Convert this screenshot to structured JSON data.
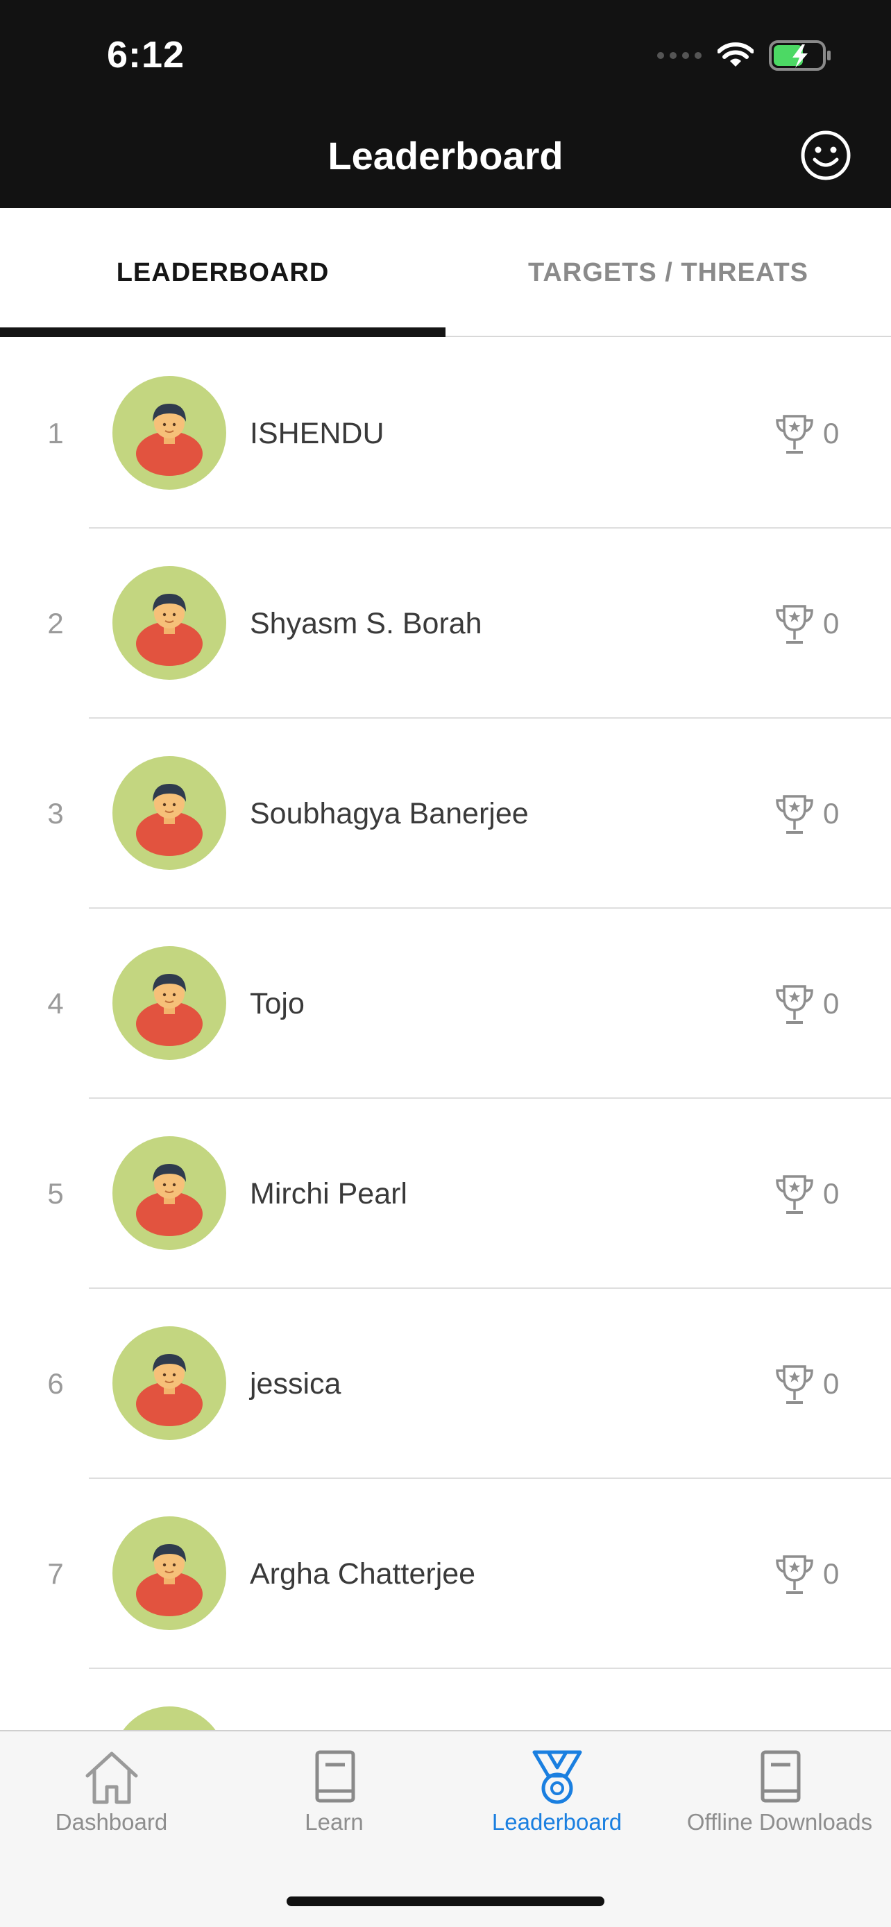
{
  "status_bar": {
    "time": "6:12"
  },
  "header": {
    "title": "Leaderboard"
  },
  "tabs": [
    {
      "label": "LEADERBOARD",
      "active": true
    },
    {
      "label": "TARGETS / THREATS",
      "active": false
    }
  ],
  "leaderboard": [
    {
      "rank": "1",
      "name": "ISHENDU",
      "score": "0"
    },
    {
      "rank": "2",
      "name": "Shyasm S. Borah",
      "score": "0"
    },
    {
      "rank": "3",
      "name": "Soubhagya Banerjee",
      "score": "0"
    },
    {
      "rank": "4",
      "name": "Tojo",
      "score": "0"
    },
    {
      "rank": "5",
      "name": "Mirchi Pearl",
      "score": "0"
    },
    {
      "rank": "6",
      "name": "jessica",
      "score": "0"
    },
    {
      "rank": "7",
      "name": "Argha Chatterjee",
      "score": "0"
    }
  ],
  "bottom_nav": [
    {
      "label": "Dashboard",
      "icon": "home-icon",
      "active": false
    },
    {
      "label": "Learn",
      "icon": "book-icon",
      "active": false
    },
    {
      "label": "Leaderboard",
      "icon": "medal-icon",
      "active": true
    },
    {
      "label": "Offline Downloads",
      "icon": "book-icon",
      "active": false
    }
  ],
  "colors": {
    "header_bg": "#121212",
    "accent": "#1a7fe0",
    "avatar_bg": "#c3d680",
    "battery": "#4cd964"
  }
}
